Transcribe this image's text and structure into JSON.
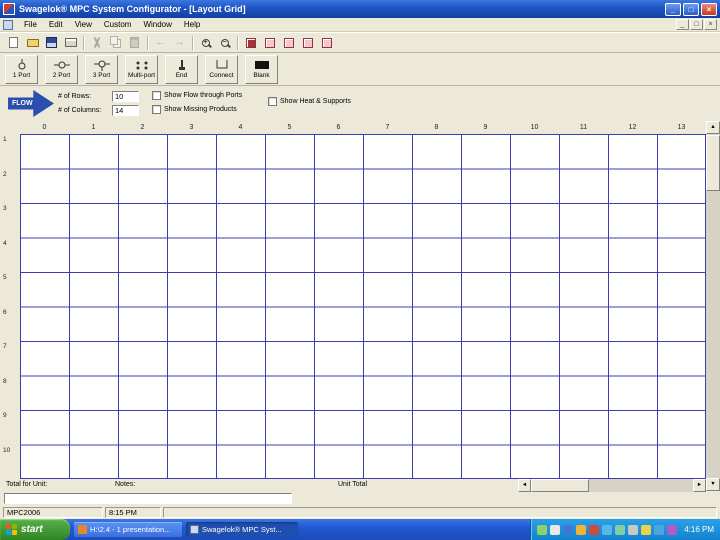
{
  "window": {
    "title": "Swagelok® MPC System Configurator  - [Layout Grid]",
    "controls": {
      "minimize": "_",
      "maximize": "□",
      "close": "×"
    }
  },
  "menu": {
    "items": [
      "File",
      "Edit",
      "View",
      "Custom",
      "Window",
      "Help"
    ]
  },
  "toolbar": {
    "icons": [
      "new",
      "open",
      "save",
      "print",
      "cut",
      "copy",
      "paste",
      "undo",
      "redo",
      "zoom-in",
      "zoom-out",
      "component-tool-1",
      "component-tool-2",
      "component-tool-3",
      "component-tool-4",
      "component-tool-5"
    ],
    "zoom_in_glyph": "+",
    "zoom_out_glyph": "−",
    "undo_glyph": "←",
    "redo_glyph": "→"
  },
  "palette": {
    "buttons": [
      "1 Port",
      "2 Port",
      "3 Port",
      "Multi-port",
      "End",
      "Connect",
      "Blank"
    ]
  },
  "flow": {
    "label": "FLOW"
  },
  "settings": {
    "rows_label": "# of Rows:",
    "rows_value": "10",
    "columns_label": "# of Columns:",
    "columns_value": "14",
    "checkboxes": [
      {
        "label": "Show Flow through Ports",
        "checked": false
      },
      {
        "label": "Show Missing Products",
        "checked": false
      },
      {
        "label": "Show Heat & Supports",
        "checked": false
      }
    ]
  },
  "grid": {
    "column_headers": [
      "0",
      "1",
      "2",
      "3",
      "4",
      "5",
      "6",
      "7",
      "8",
      "9",
      "10",
      "11",
      "12",
      "13"
    ],
    "row_headers": [
      "1",
      "2",
      "3",
      "4",
      "5",
      "6",
      "7",
      "8",
      "9",
      "10"
    ],
    "line_color": "#3c3cb4"
  },
  "scroll": {
    "up": "▲",
    "down": "▼",
    "left": "◄",
    "right": "►"
  },
  "footer": {
    "total_for_unit_label": "Total for Unit:",
    "notes_label": "Notes:",
    "unit_total_label": "Unit Total"
  },
  "statusbar": {
    "project": "MPC2006",
    "time": "8:15 PM"
  },
  "taskbar": {
    "start_label": "start",
    "tasks": [
      {
        "label": "H:\\2.4 - 1 presentation..."
      },
      {
        "label": "Swagelok® MPC Syst..."
      }
    ],
    "tray_icons": [
      {
        "name": "tray-icon-1",
        "color": "#8ed06c"
      },
      {
        "name": "tray-icon-2",
        "color": "#e8e8e8"
      },
      {
        "name": "tray-icon-3",
        "color": "#3f77d4"
      },
      {
        "name": "tray-icon-4",
        "color": "#f2b233"
      },
      {
        "name": "tray-icon-5",
        "color": "#d14a3a"
      },
      {
        "name": "tray-icon-6",
        "color": "#58b6e8"
      },
      {
        "name": "tray-icon-7",
        "color": "#7fd0a0"
      },
      {
        "name": "tray-icon-8",
        "color": "#c8c8c8"
      },
      {
        "name": "tray-icon-9",
        "color": "#e8d44c"
      },
      {
        "name": "tray-icon-10",
        "color": "#4fa3e0"
      },
      {
        "name": "tray-icon-11",
        "color": "#b05cc4"
      }
    ],
    "clock": "4:16 PM"
  }
}
